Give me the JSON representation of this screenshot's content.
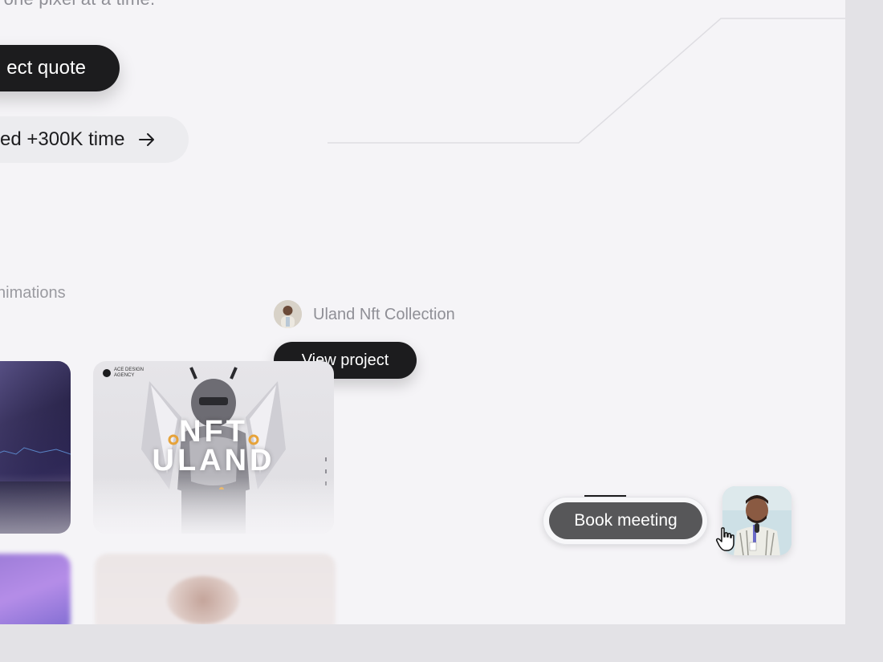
{
  "hero": {
    "tagline": ", one pixel at a time.",
    "quote_button": "ect quote",
    "stats_label": "ed +300K time"
  },
  "section": {
    "category_label": "nimations"
  },
  "project": {
    "title": "Uland Nft Collection",
    "view_button": "View project",
    "card_logo_line1": "ACE DESIGN",
    "card_logo_line2": "AGENCY",
    "card_title_line1": "NFT",
    "card_title_line2": "ULAND"
  },
  "contact": {
    "book_button": "Book meeting"
  },
  "icons": {
    "stats_arrow": "arrow-right-icon",
    "cursor": "hand-pointer-icon"
  },
  "colors": {
    "primary_button": "#1c1c1e",
    "book_button": "#575759",
    "background": "#f5f4f7",
    "outer": "#e3e2e6"
  }
}
